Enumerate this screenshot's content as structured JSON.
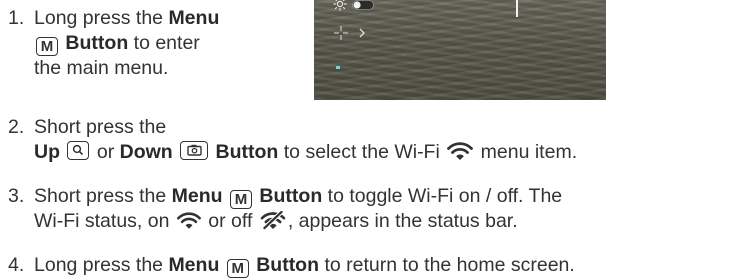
{
  "steps": [
    {
      "number": "1.",
      "lines": [
        {
          "pre": "Long press the ",
          "bold": "Menu"
        },
        {
          "key": "M",
          "bold": "Button",
          "post": " to enter"
        },
        {
          "text": "the main menu."
        }
      ]
    },
    {
      "number": "2.",
      "line1": "Short press the",
      "up_label": "Up",
      "up_key": "magnifier-key",
      "or_text": "or",
      "down_label": "Down",
      "down_key": "camera-key",
      "button_label": "Button",
      "post": "to select the Wi-Fi",
      "post_icon": "wifi-icon",
      "end": "menu item."
    },
    {
      "number": "3.",
      "pre": "Short press the",
      "menu_label": "Menu",
      "key": "M",
      "button_label": "Button",
      "post": "to toggle Wi-Fi on / off. The",
      "line2_pre": "Wi-Fi status, on",
      "on_icon": "wifi-icon",
      "or_off": "or off",
      "off_icon": "wifi-off-icon",
      "line2_post": ", appears in the status bar."
    },
    {
      "number": "4.",
      "pre": "Long press the",
      "menu_label": "Menu",
      "key": "M",
      "button_label": "Button",
      "post": "to return to the home screen."
    }
  ],
  "thumbnail": {
    "icons": [
      "brightness-icon",
      "toggle-switch-icon",
      "crosshair-icon",
      "chevron-right-icon",
      "indicator-dot-icon"
    ],
    "background_color": "#5f5d50"
  }
}
